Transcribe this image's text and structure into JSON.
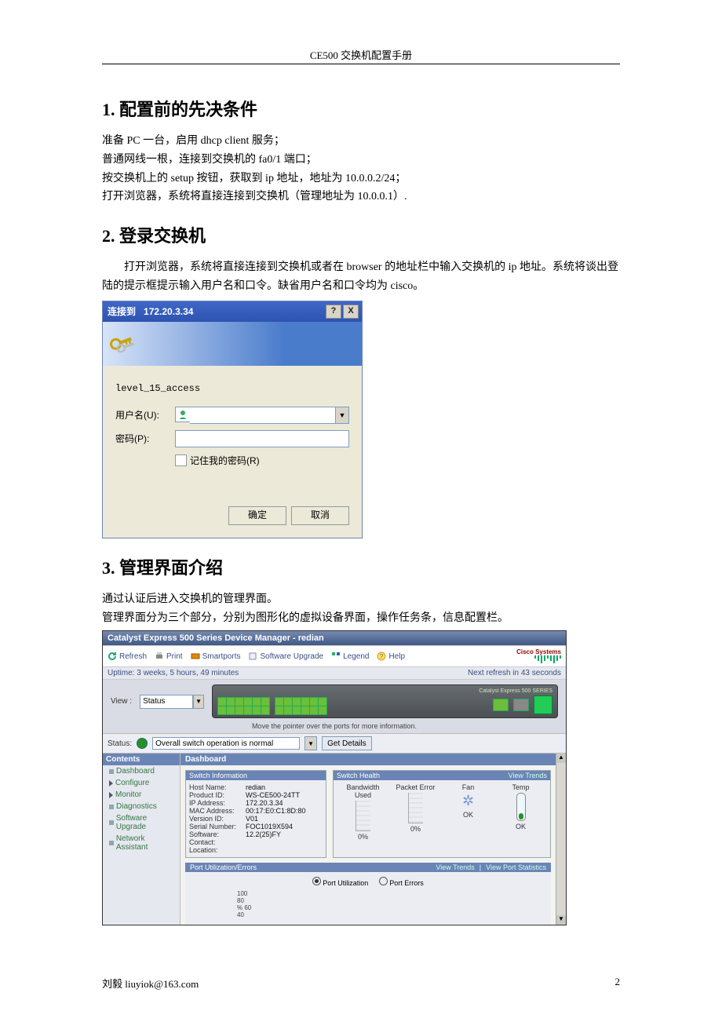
{
  "doc_header": "CE500 交换机配置手册",
  "section1": {
    "title": "1. 配置前的先决条件",
    "lines": [
      "准备 PC 一台，启用 dhcp client 服务；",
      "普通网线一根，连接到交换机的 fa0/1 端口；",
      "按交换机上的 setup 按钮，获取到 ip 地址，地址为 10.0.0.2/24；",
      "打开浏览器，系统将直接连接到交换机（管理地址为 10.0.0.1）."
    ]
  },
  "section2": {
    "title": "2. 登录交换机",
    "para": "打开浏览器，系统将直接连接到交换机或者在 browser 的地址栏中输入交换机的 ip 地址。系统将谈出登陆的提示框提示输入用户名和口令。缺省用户名和口令均为 cisco。"
  },
  "login_dialog": {
    "title_prefix": "连接到",
    "title_host": "172.20.3.34",
    "help_btn": "?",
    "close_btn": "X",
    "access": "level_15_access",
    "username_label": "用户名(U):",
    "password_label": "密码(P):",
    "remember_label": "记住我的密码(R)",
    "ok": "确定",
    "cancel": "取消"
  },
  "section3": {
    "title": "3. 管理界面介绍",
    "para1": "通过认证后进入交换机的管理界面。",
    "para2": "管理界面分为三个部分，分别为图形化的虚拟设备界面，操作任务条，信息配置栏。"
  },
  "dm": {
    "title": "Catalyst Express 500 Series Device Manager - redian",
    "toolbar": {
      "refresh": "Refresh",
      "print": "Print",
      "smartports": "Smartports",
      "upgrade": "Software Upgrade",
      "legend": "Legend",
      "help": "Help",
      "logo": "Cisco Systems"
    },
    "uptime": "Uptime: 3 weeks, 5 hours, 49 minutes",
    "next_refresh": "Next refresh in 43 seconds",
    "view_label": "View :",
    "view_value": "Status",
    "switch_model": "Catalyst Express 500 SERIES",
    "hint": "Move the pointer over the ports for more information.",
    "status_label": "Status:",
    "status_text": "Overall switch operation is normal",
    "get_details": "Get Details",
    "sidebar_header": "Contents",
    "sidebar": [
      "Dashboard",
      "Configure",
      "Monitor",
      "Diagnostics",
      "Software Upgrade",
      "Network Assistant"
    ],
    "dashboard_header": "Dashboard",
    "switch_info_header": "Switch Information",
    "switch_info": {
      "Host Name:": "redian",
      "Product ID:": "WS-CE500-24TT",
      "IP Address:": "172.20.3.34",
      "MAC Address:": "00:17:E0:C1:8D:80",
      "Version ID:": "V01",
      "Serial Number:": "FOC1019X594",
      "Software:": "12.2(25)FY",
      "Contact:": "",
      "Location:": ""
    },
    "switch_health_header": "Switch Health",
    "view_trends": "View Trends",
    "health_cols": {
      "bw": "Bandwidth Used",
      "bw_val": "0%",
      "pe": "Packet Error",
      "pe_val": "0%",
      "fan": "Fan",
      "fan_val": "OK",
      "temp": "Temp",
      "temp_val": "OK"
    },
    "port_util_header": "Port Utilization/Errors",
    "view_port_stats": "View Port Statistics",
    "radio_util": "Port Utilization",
    "radio_err": "Port Errors",
    "yaxis": [
      "100",
      "80",
      "60",
      "40"
    ],
    "yaxis_label": "%"
  },
  "footer": {
    "left": "刘毅  liuyiok@163.com",
    "right": "2"
  }
}
